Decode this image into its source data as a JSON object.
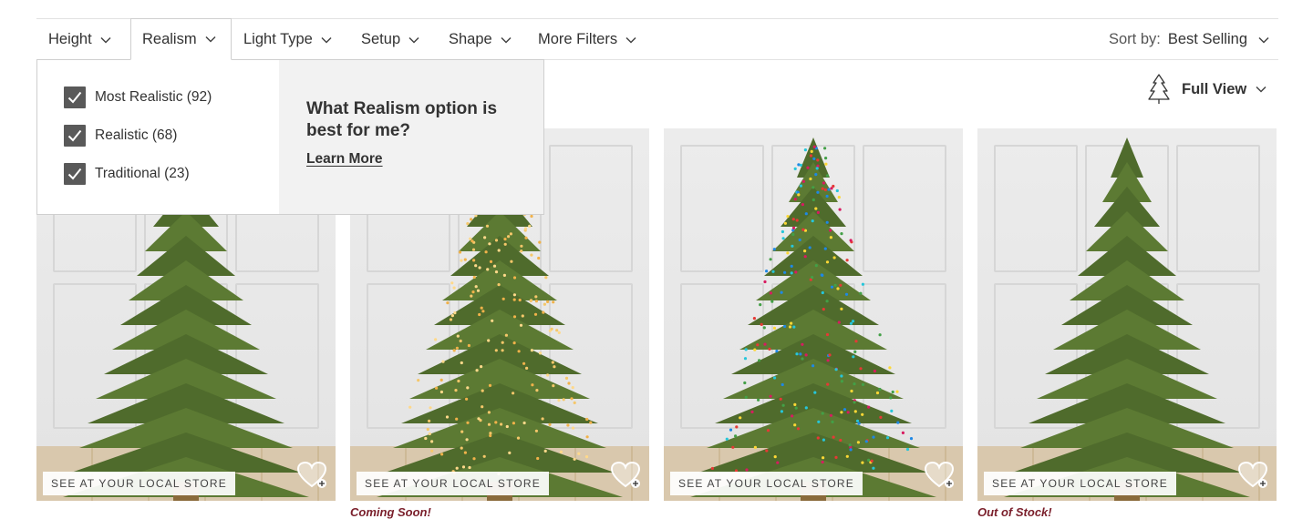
{
  "filters": {
    "items": [
      {
        "label": "Height"
      },
      {
        "label": "Realism"
      },
      {
        "label": "Light Type"
      },
      {
        "label": "Setup"
      },
      {
        "label": "Shape"
      },
      {
        "label": "More Filters"
      }
    ],
    "active": "Realism",
    "sort_label": "Sort by:",
    "sort_value": "Best Selling"
  },
  "realism_dropdown": {
    "options": [
      {
        "label": "Most Realistic (92)",
        "checked": true
      },
      {
        "label": "Realistic (68)",
        "checked": true
      },
      {
        "label": "Traditional (23)",
        "checked": true
      }
    ],
    "help_title": "What Realism option is best for me?",
    "help_link": "Learn More"
  },
  "view": {
    "label": "Full View",
    "icon": "tree-outline-icon"
  },
  "products": [
    {
      "badge": "SEE AT YOUR LOCAL STORE",
      "status": "",
      "lights": "none"
    },
    {
      "badge": "SEE AT YOUR LOCAL STORE",
      "status": "Coming Soon!",
      "lights": "warm-white"
    },
    {
      "badge": "SEE AT YOUR LOCAL STORE",
      "status": "",
      "lights": "multicolor"
    },
    {
      "badge": "SEE AT YOUR LOCAL STORE",
      "status": "Out of Stock!",
      "lights": "none"
    }
  ],
  "colors": {
    "status_red": "#7a1f2b",
    "checkbox": "#595959",
    "help_bg": "#f2f2f2"
  }
}
